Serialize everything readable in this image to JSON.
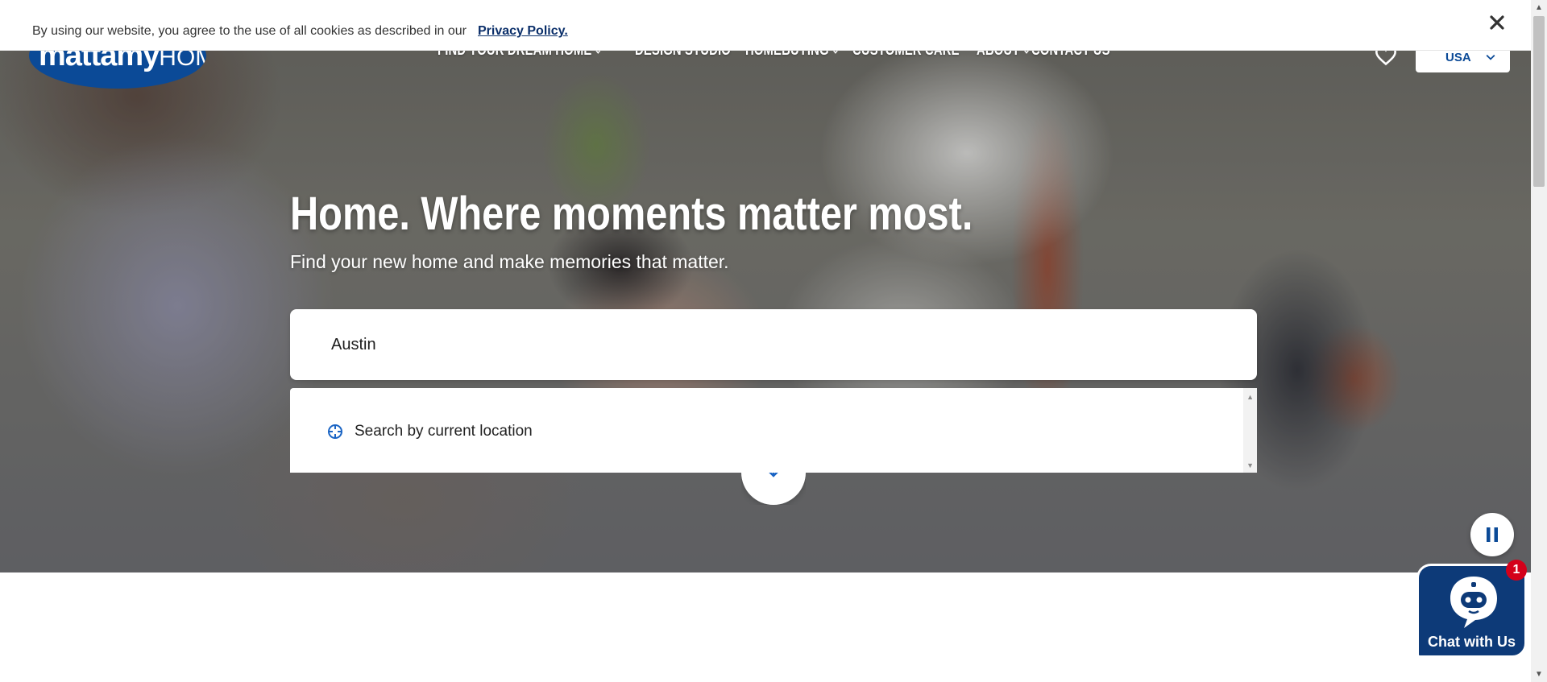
{
  "cookie_banner": {
    "text": "By using our website, you agree to the use of all cookies as described in our",
    "link_label": "Privacy Policy.",
    "close_icon": "close-icon"
  },
  "header": {
    "logo": {
      "bold": "mattamy",
      "light": "HOMES"
    },
    "nav": [
      {
        "label": "FIND YOUR DREAM HOME",
        "has_dropdown": true
      },
      {
        "label": "DESIGN STUDIO",
        "has_dropdown": false
      },
      {
        "label": "HOMEBUYING",
        "has_dropdown": true
      },
      {
        "label": "CUSTOMER CARE",
        "has_dropdown": false
      },
      {
        "label": "ABOUT",
        "has_dropdown": true
      },
      {
        "label": "CONTACT US",
        "has_dropdown": false
      }
    ],
    "favorites_icon": "heart-icon",
    "country_selector": {
      "value": "USA"
    }
  },
  "hero": {
    "title": "Home. Where moments matter most.",
    "subtitle": "Find your new home and make memories that matter."
  },
  "search": {
    "value": "Austin",
    "suggestions": [
      {
        "label": "Search by current location",
        "icon": "crosshair-icon"
      }
    ]
  },
  "controls": {
    "scroll_down_icon": "arrow-down-icon",
    "pause_icon": "pause-icon"
  },
  "chat": {
    "label": "Chat with Us",
    "badge_count": "1",
    "icon": "robot-icon"
  },
  "colors": {
    "brand_blue": "#0b4a97",
    "chat_blue": "#0d3a78",
    "badge_red": "#d4001a",
    "link_navy": "#0b2f6a"
  }
}
